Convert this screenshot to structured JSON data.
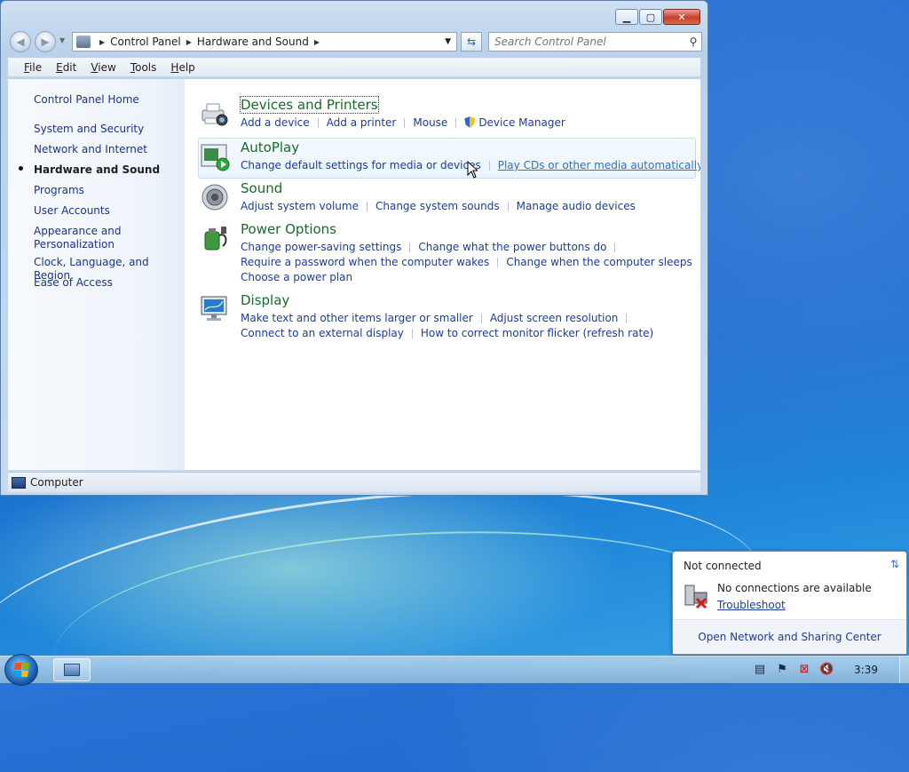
{
  "window": {
    "address": {
      "crumbs": [
        "Control Panel",
        "Hardware and Sound"
      ]
    },
    "search_placeholder": "Search Control Panel",
    "menu": [
      "File",
      "Edit",
      "View",
      "Tools",
      "Help"
    ],
    "sidebar": {
      "items": [
        "Control Panel Home",
        "System and Security",
        "Network and Internet",
        "Hardware and Sound",
        "Programs",
        "User Accounts",
        "Appearance and Personalization",
        "Clock, Language, and Region",
        "Ease of Access"
      ],
      "current": "Hardware and Sound"
    },
    "categories": [
      {
        "title": "Devices and Printers",
        "rows": [
          [
            "Add a device",
            "Add a printer",
            "Mouse",
            "Device Manager"
          ]
        ]
      },
      {
        "title": "AutoPlay",
        "rows": [
          [
            "Change default settings for media or devices",
            "Play CDs or other media automatically"
          ]
        ]
      },
      {
        "title": "Sound",
        "rows": [
          [
            "Adjust system volume",
            "Change system sounds",
            "Manage audio devices"
          ]
        ]
      },
      {
        "title": "Power Options",
        "rows": [
          [
            "Change power-saving settings",
            "Change what the power buttons do"
          ],
          [
            "Require a password when the computer wakes",
            "Change when the computer sleeps"
          ],
          [
            "Choose a power plan"
          ]
        ]
      },
      {
        "title": "Display",
        "rows": [
          [
            "Make text and other items larger or smaller",
            "Adjust screen resolution"
          ],
          [
            "Connect to an external display",
            "How to correct monitor flicker (refresh rate)"
          ]
        ]
      }
    ],
    "status": "Computer"
  },
  "notification": {
    "title": "Not connected",
    "message": "No connections are available",
    "link": "Troubleshoot",
    "footer": "Open Network and Sharing Center"
  },
  "taskbar": {
    "clock": "3:39"
  }
}
